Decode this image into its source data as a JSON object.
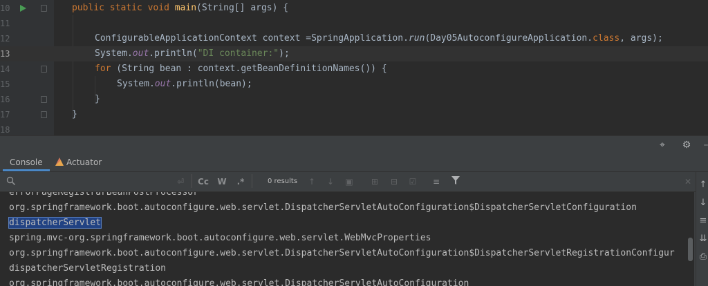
{
  "editor": {
    "line_numbers": [
      "10",
      "11",
      "12",
      "13",
      "14",
      "15",
      "16",
      "17",
      "18"
    ],
    "current_line": "13",
    "code": {
      "l10": {
        "public": "public",
        "static": "static",
        "void": "void",
        "main": "main",
        "rest": "(String[] args) {"
      },
      "l12": {
        "a": "ConfigurableApplicationContext context =SpringApplication.",
        "run": "run",
        "b": "(Day05AutoconfigureApplication.",
        "cls": "class",
        "c": ", args);"
      },
      "l13": {
        "a": "System.",
        "out": "out",
        "b": ".println(",
        "str": "\"DI container:\"",
        "c": ");"
      },
      "l14": {
        "for": "for",
        "rest": " (String bean : context.getBeanDefinitionNames()) {"
      },
      "l15": {
        "a": "System.",
        "out": "out",
        "b": ".println(bean);"
      },
      "l16": "}",
      "l17": "}"
    }
  },
  "toolwindow": {
    "tabs": [
      {
        "label": "Console",
        "active": true
      },
      {
        "label": "Actuator",
        "active": false
      }
    ],
    "header_icons": [
      "crosshair-icon",
      "gear-icon"
    ],
    "find": {
      "search_icon": "search-icon",
      "results": "0 results",
      "options": [
        "Cc",
        "W",
        ".*"
      ]
    },
    "console_lines": [
      "errorPageRegistrarBeanPostProcessor",
      "org.springframework.boot.autoconfigure.web.servlet.DispatcherServletAutoConfiguration$DispatcherServletConfiguration",
      "dispatcherServlet",
      "spring.mvc-org.springframework.boot.autoconfigure.web.servlet.WebMvcProperties",
      "org.springframework.boot.autoconfigure.web.servlet.DispatcherServletAutoConfiguration$DispatcherServletRegistrationConfigur",
      "dispatcherServletRegistration",
      "org.springframework.boot.autoconfigure.web.servlet.DispatcherServletAutoConfiguration"
    ],
    "selected_line_index": 2
  },
  "colors": {
    "keyword": "#cc7832",
    "function": "#ffc66d",
    "static_field": "#9876aa",
    "string": "#6a8759",
    "selection": "#214283",
    "run": "#499c54"
  }
}
